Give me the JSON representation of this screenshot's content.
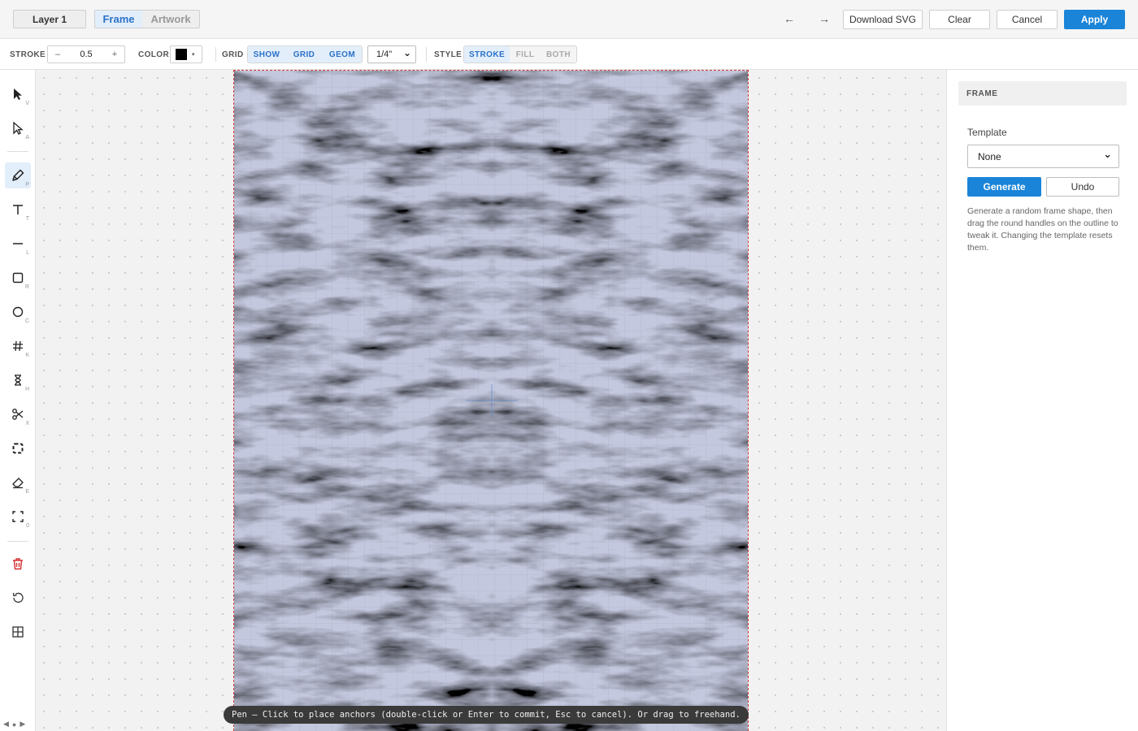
{
  "topbar": {
    "layer_label": "Layer 1",
    "mode_tabs": [
      "Frame",
      "Artwork"
    ],
    "active_mode": "Frame",
    "undo_arrow": "←",
    "redo_arrow": "→",
    "download_label": "Download SVG",
    "clear_label": "Clear",
    "cancel_label": "Cancel",
    "apply_label": "Apply"
  },
  "options": {
    "stroke_label": "STROKE",
    "stroke_minus": "–",
    "stroke_value": "0.5",
    "stroke_plus": "+",
    "color_label": "COLOR",
    "color_value": "#000000",
    "color_caret": "▾",
    "grid_label": "GRID",
    "grid_toggles": [
      "SHOW",
      "GRID",
      "GEOM"
    ],
    "grid_size": "1/4\"",
    "grid_caret": "⌄",
    "style_label": "STYLE",
    "style_options": [
      "STROKE",
      "FILL",
      "BOTH"
    ],
    "active_style": "STROKE"
  },
  "tools": [
    {
      "name": "select-tool",
      "icon": "arrow-pointer-icon",
      "key": "V"
    },
    {
      "name": "direct-select-tool",
      "icon": "arrow-outline-icon",
      "key": "A"
    },
    {
      "name": "pen-tool",
      "icon": "pen-icon",
      "key": "P",
      "active": true
    },
    {
      "name": "text-tool",
      "icon": "text-icon",
      "key": "T"
    },
    {
      "name": "line-tool",
      "icon": "line-icon",
      "key": "L"
    },
    {
      "name": "rectangle-tool",
      "icon": "square-icon",
      "key": "R"
    },
    {
      "name": "circle-tool",
      "icon": "circle-icon",
      "key": "C"
    },
    {
      "name": "grid-tool",
      "icon": "hash-icon",
      "key": "K"
    },
    {
      "name": "hourglass-tool",
      "icon": "hourglass-icon",
      "key": "H"
    },
    {
      "name": "scissors-tool",
      "icon": "scissors-icon",
      "key": "X"
    },
    {
      "name": "frame-select-tool",
      "icon": "dashed-square-icon",
      "key": ""
    },
    {
      "name": "eraser-tool",
      "icon": "eraser-icon",
      "key": "E"
    },
    {
      "name": "fit-tool",
      "icon": "corners-icon",
      "key": "0"
    },
    {
      "name": "delete-tool",
      "icon": "trash-icon",
      "key": ""
    },
    {
      "name": "reset-tool",
      "icon": "rotate-ccw-icon",
      "key": ""
    },
    {
      "name": "layout-tool",
      "icon": "grid-2x2-icon",
      "key": ""
    }
  ],
  "scroll_controls": [
    "◀",
    "●",
    "▶"
  ],
  "status_text": "Pen — Click to place anchors (double-click or Enter to commit, Esc to cancel). Or drag to freehand.",
  "panel": {
    "title": "FRAME",
    "template_label": "Template",
    "template_value": "None",
    "template_caret": "⌄",
    "generate_label": "Generate",
    "undo_label": "Undo",
    "help_text": "Generate a random frame shape, then drag the round handles on the outline to tweak it. Changing the template resets them."
  },
  "colors": {
    "accent": "#1a84d8",
    "active_tab_text": "#2a72c8",
    "active_tab_bg": "#e3eefb",
    "artboard_border": "#d23a3a",
    "delete_red": "#d33030"
  }
}
